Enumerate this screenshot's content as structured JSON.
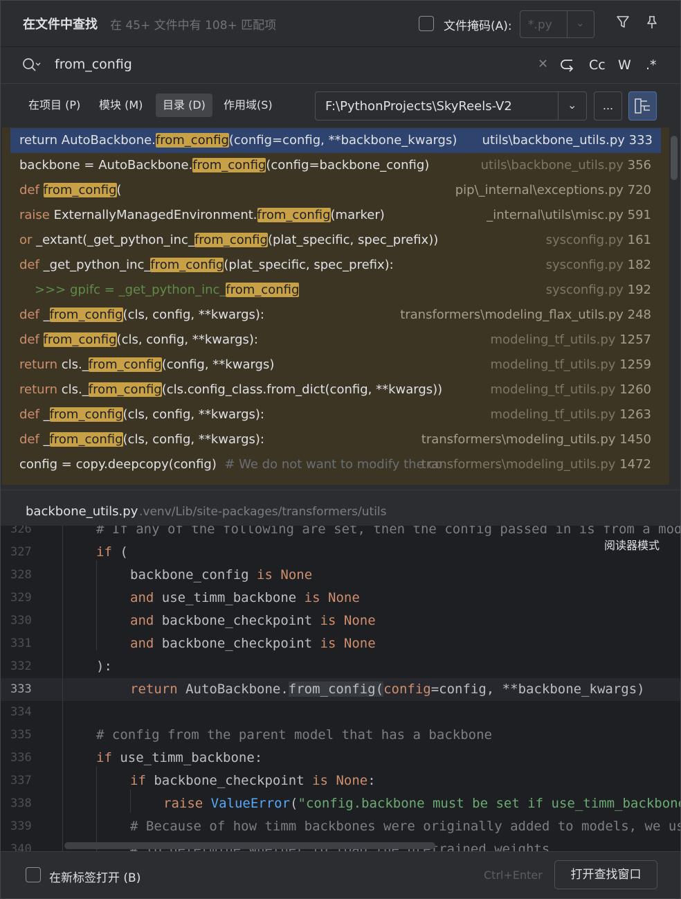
{
  "header": {
    "title": "在文件中查找",
    "match_info": "在 45+ 文件中有 108+ 匹配项",
    "file_mask_label": "文件掩码(A):",
    "file_mask_placeholder": "*.py"
  },
  "search": {
    "query": "from_config",
    "opt_case": "Cc",
    "opt_word": "W",
    "opt_regex": ".*"
  },
  "scope": {
    "tabs": [
      "在项目 (P)",
      "模块 (M)",
      "目录 (D)",
      "作用域(S)"
    ],
    "active_tab": "目录 (D)",
    "directory": "F:\\PythonProjects\\SkyReels-V2",
    "browse_label": "..."
  },
  "results": [
    {
      "pre": "return AutoBackbone.",
      "match": "from_config",
      "post": "(config=config, **backbone_kwargs)",
      "file": "utils\\backbone_utils.py",
      "line": "333",
      "selected": true
    },
    {
      "pre": "backbone = AutoBackbone.",
      "match": "from_config",
      "post": "(config=backbone_config)",
      "file": "utils\\backbone_utils.py",
      "line": "356"
    },
    {
      "kw": "def ",
      "pre": "",
      "match": "from_config",
      "post": "(",
      "file": "pip\\_internal\\exceptions.py",
      "line": "720"
    },
    {
      "kw": "raise ",
      "pre": "ExternallyManagedEnvironment.",
      "match": "from_config",
      "post": "(marker)",
      "file": "_internal\\utils\\misc.py",
      "line": "591"
    },
    {
      "kw": "or ",
      "pre": "_extant(_get_python_inc_",
      "match": "from_config",
      "post": "(plat_specific, spec_prefix))",
      "file": "sysconfig.py",
      "line": "161"
    },
    {
      "kw": "def ",
      "pre": "_get_python_inc_",
      "match": "from_config",
      "post": "(plat_specific, spec_prefix):",
      "file": "sysconfig.py",
      "line": "182"
    },
    {
      "prompt": ">>> gpifc = _get_python_inc_",
      "match": "from_config",
      "post": "",
      "file": "sysconfig.py",
      "line": "192"
    },
    {
      "kw": "def ",
      "pre": "_",
      "match": "from_config",
      "post": "(cls, config, **kwargs):",
      "file": "transformers\\modeling_flax_utils.py",
      "line": "248"
    },
    {
      "kw": "def ",
      "pre": "",
      "match": "from_config",
      "post": "(cls, config, **kwargs):",
      "file": "modeling_tf_utils.py",
      "line": "1257"
    },
    {
      "kw": "return ",
      "pre": "cls._",
      "match": "from_config",
      "post": "(config, **kwargs)",
      "file": "modeling_tf_utils.py",
      "line": "1259"
    },
    {
      "kw": "return ",
      "pre": "cls._",
      "match": "from_config",
      "post": "(cls.config_class.from_dict(config, **kwargs))",
      "file": "modeling_tf_utils.py",
      "line": "1260"
    },
    {
      "kw": "def ",
      "pre": "_",
      "match": "from_config",
      "post": "(cls, config, **kwargs):",
      "file": "modeling_tf_utils.py",
      "line": "1263"
    },
    {
      "kw": "def ",
      "pre": "_",
      "match": "from_config",
      "post": "(cls, config, **kwargs):",
      "file": "transformers\\modeling_utils.py",
      "line": "1450"
    },
    {
      "pre": "config = copy.deepcopy(config)",
      "comment": "  # We do not want to modify the co",
      "match": "",
      "post": "",
      "file": "transformers\\modeling_utils.py",
      "line": "1472"
    }
  ],
  "preview": {
    "file_name": "backbone_utils.py",
    "file_path": ".venv/Lib/site-packages/transformers/utils",
    "reader_mode": "阅读器模式",
    "lines": [
      {
        "n": "326",
        "text": "# If any of the following are set, then the config passed in is from a model which contains a backbone."
      },
      {
        "n": "327",
        "text": "if ("
      },
      {
        "n": "328",
        "text": "backbone_config is None"
      },
      {
        "n": "329",
        "text": "and use_timm_backbone is None"
      },
      {
        "n": "330",
        "text": "and backbone_checkpoint is None"
      },
      {
        "n": "331",
        "text": "and backbone_checkpoint is None"
      },
      {
        "n": "332",
        "text": "):"
      },
      {
        "n": "333",
        "text": "return AutoBackbone.from_config(config=config, **backbone_kwargs)"
      },
      {
        "n": "334",
        "text": ""
      },
      {
        "n": "335",
        "text": "# config from the parent model that has a backbone"
      },
      {
        "n": "336",
        "text": "if use_timm_backbone:"
      },
      {
        "n": "337",
        "text": "if backbone_checkpoint is None:"
      },
      {
        "n": "338",
        "text": "raise ValueError(\"config.backbone must be set if use_timm_backbone is True\")"
      },
      {
        "n": "339",
        "text": "# Because of how timm backbones were originally added to models, we use the"
      },
      {
        "n": "340",
        "text": "# to determine whether to load the pretrained weights"
      }
    ]
  },
  "footer": {
    "open_in_new_tab": "在新标签打开 (B)",
    "shortcut": "Ctrl+Enter",
    "open_window": "打开查找窗口"
  },
  "icons": [
    "search-icon",
    "filter-icon",
    "pin-icon",
    "clear-icon",
    "replace-icon",
    "chevron-down-icon",
    "preview-icon"
  ]
}
